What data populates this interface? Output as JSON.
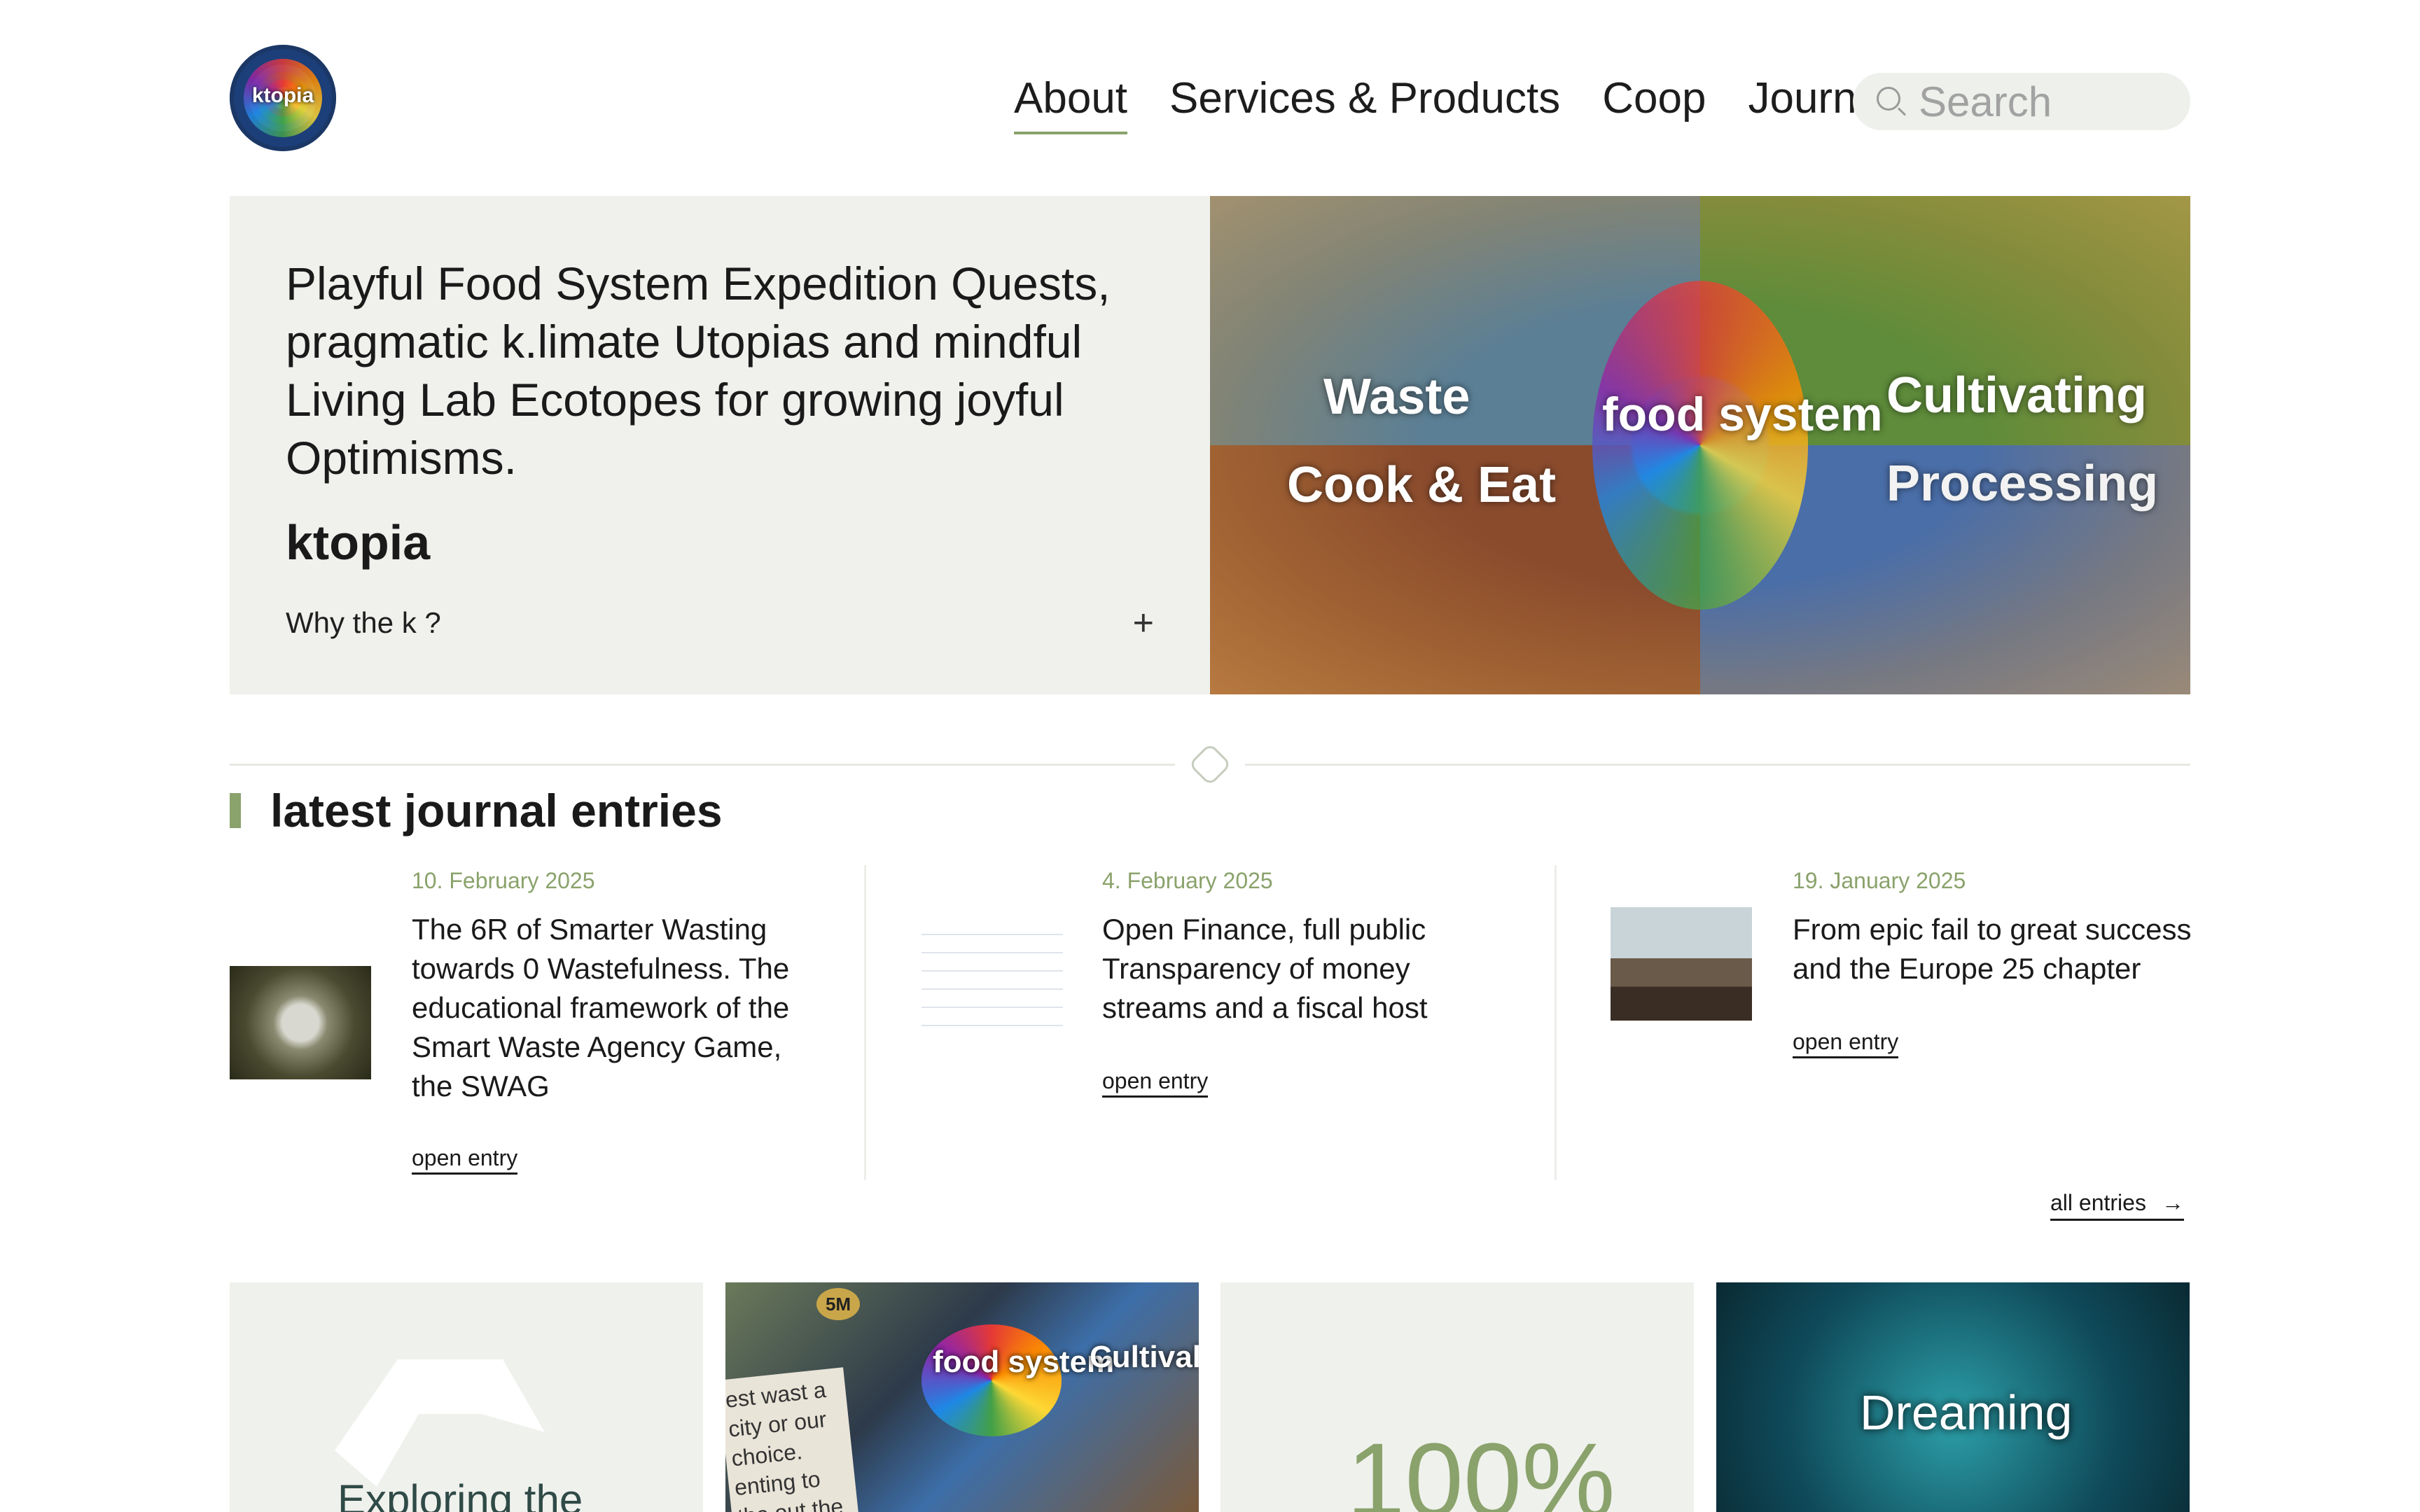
{
  "header": {
    "logo_text": "ktopia",
    "nav": [
      "About",
      "Services & Products",
      "Coop",
      "Journal"
    ],
    "active_nav": "About",
    "search_placeholder": "Search"
  },
  "hero": {
    "text": "Playful Food System Expedition Quests, pragmatic k.limate Utopias and mindful Living Lab Ecotopes for growing joyful Optimisms.",
    "brand": "ktopia",
    "why_label": "Why the k ?",
    "expand_symbol": "+",
    "image_labels": {
      "waste": "Waste",
      "cook_eat": "Cook & Eat",
      "cultivating": "Cultivating",
      "processing": "Processing",
      "center": "food system"
    }
  },
  "journal": {
    "title": "latest journal entries",
    "entries": [
      {
        "date": "10. February 2025",
        "title": "The 6R of Smarter Wasting towards 0 Wastefulness. The educational framework of the Smart Waste Agency Game, the SWAG",
        "link": "open entry"
      },
      {
        "date": "4. February 2025",
        "title": "Open Finance, full public Transparency of money streams and a fiscal host",
        "link": "open entry"
      },
      {
        "date": "19. January 2025",
        "title": "From epic fail to great success and the Europe 25 chapter",
        "link": "open entry"
      }
    ],
    "all_entries": "all entries",
    "arrow": "→"
  },
  "cards": {
    "card1_text": "Exploring the",
    "card2_badge": "5M",
    "card2_label": "food system",
    "card2_cult": "Cultival",
    "card2_note": "est wast a city or our choice. enting to the out the",
    "card3_text": "100%",
    "card4_text": "Dreaming"
  },
  "colors": {
    "accent": "#8aa26b",
    "panel": "#f0f1ed",
    "search_bg": "#eef0ec"
  }
}
